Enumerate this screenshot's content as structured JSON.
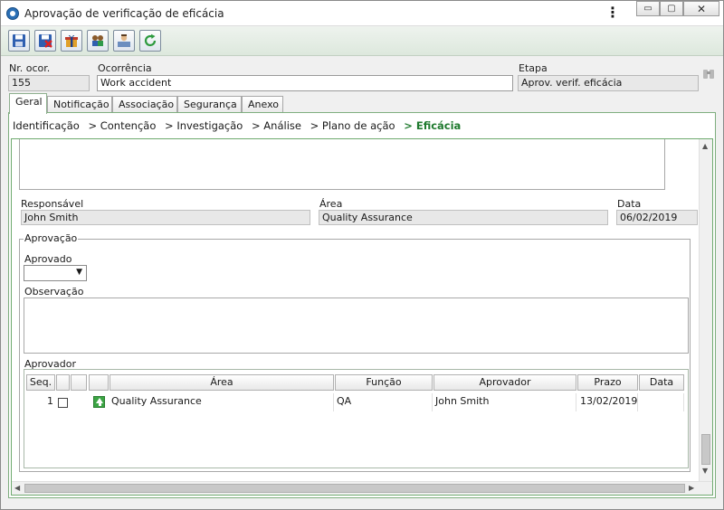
{
  "window": {
    "title": "Aprovação de verificação de eficácia",
    "menu_glyph": "⋮",
    "min_glyph": "▭",
    "max_glyph": "▢",
    "close_glyph": "✕"
  },
  "toolbar": {
    "buttons": [
      {
        "icon": "save-icon"
      },
      {
        "icon": "save-close-icon"
      },
      {
        "icon": "gift-icon"
      },
      {
        "icon": "users-search-icon"
      },
      {
        "icon": "document-user-icon"
      },
      {
        "icon": "refresh-icon"
      }
    ]
  },
  "header": {
    "nr_label": "Nr. ocor.",
    "nr_value": "155",
    "ocorrencia_label": "Ocorrência",
    "ocorrencia_value": "Work accident",
    "etapa_label": "Etapa",
    "etapa_value": "Aprov. verif. eficácia"
  },
  "tabs": [
    "Geral",
    "Notificação",
    "Associação",
    "Segurança",
    "Anexo"
  ],
  "active_tab": "Geral",
  "breadcrumb": {
    "steps": [
      "Identificação",
      "> Contenção",
      "> Investigação",
      "> Análise",
      "> Plano de ação",
      "> Eficácia"
    ],
    "active": "> Eficácia"
  },
  "details": {
    "responsavel_label": "Responsável",
    "responsavel_value": "John Smith",
    "area_label": "Área",
    "area_value": "Quality Assurance",
    "data_label": "Data",
    "data_value": "06/02/2019"
  },
  "approval": {
    "legend": "Aprovação",
    "aprovado_label": "Aprovado",
    "aprovado_value": "",
    "observacao_label": "Observação",
    "observacao_value": "",
    "aprovador_label": "Aprovador",
    "columns": [
      "Seq.",
      "",
      "",
      "",
      "Área",
      "Função",
      "Aprovador",
      "Prazo",
      "Data"
    ],
    "rows": [
      {
        "seq": "1",
        "area": "Quality Assurance",
        "funcao": "QA",
        "aprovador": "John Smith",
        "prazo": "13/02/2019",
        "data": ""
      }
    ]
  },
  "colors": {
    "accent_green": "#1f7a2e",
    "panel_border": "#7fae7f"
  }
}
